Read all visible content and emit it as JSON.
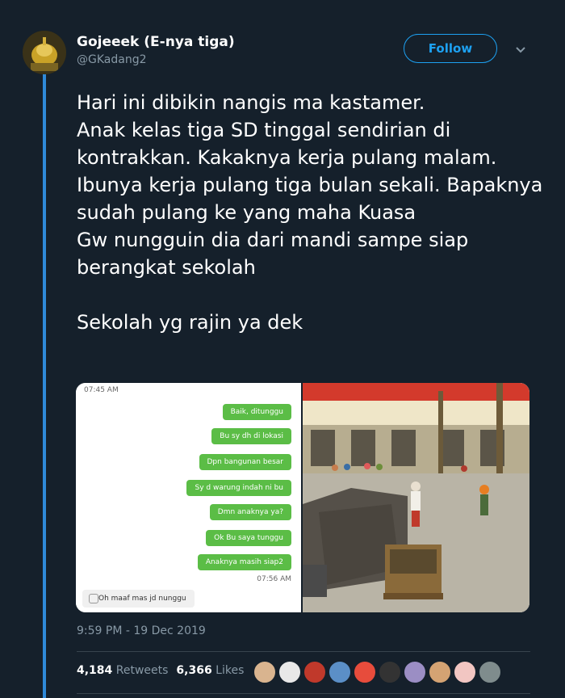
{
  "tweet": {
    "display_name": "Gojeeek (E-nya tiga)",
    "handle": "@GKadang2",
    "follow_label": "Follow",
    "text": "Hari ini dibikin nangis ma kastamer.\nAnak kelas tiga SD tinggal sendirian di kontrakkan. Kakaknya kerja pulang malam. Ibunya kerja pulang tiga bulan sekali. Bapaknya sudah pulang ke yang maha Kuasa\nGw nungguin dia dari mandi sampe siap berangkat sekolah\n\nSekolah yg rajin ya dek",
    "timestamp": "9:59 PM - 19 Dec 2019",
    "retweets_count": "4,184",
    "retweets_label": "Retweets",
    "likes_count": "6,366",
    "likes_label": "Likes"
  },
  "chat": {
    "time_top": "07:45 AM",
    "messages": [
      "Baik, ditunggu",
      "Bu sy dh di lokasi",
      "Dpn bangunan besar",
      "Sy d warung indah ni bu",
      "Dmn anaknya ya?",
      "Ok Bu saya tunggu",
      "Anaknya masih siap2"
    ],
    "time_bottom": "07:56 AM",
    "reply": "Oh maaf mas jd nunggu"
  },
  "icons": {
    "chevron": "chevron-down-icon",
    "accent": "#1da1f2",
    "thread": "#2f8ad9"
  },
  "liker_colors": [
    "#d9b48f",
    "#e8e8e8",
    "#c0392b",
    "#5b8fc7",
    "#e74c3c",
    "#333333",
    "#9b8ec4",
    "#d4a373",
    "#f2c6c2",
    "#7f8c8d"
  ]
}
